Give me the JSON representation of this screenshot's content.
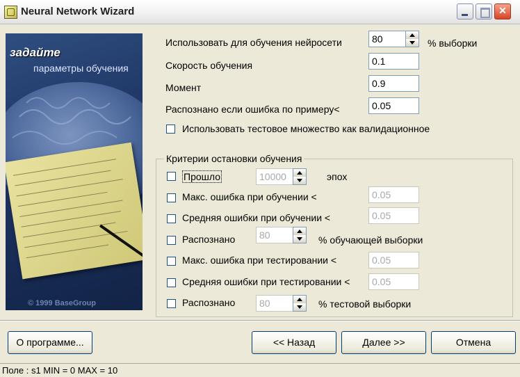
{
  "window": {
    "title": "Neural Network Wizard"
  },
  "side_image": {
    "heading": "задайте",
    "subheading": "параметры обучения",
    "copyright": "© 1999 BaseGroup"
  },
  "training": {
    "sample_use_label": "Использовать для обучения нейросети",
    "sample_use_value": "80",
    "sample_use_unit": "% выборки",
    "learning_rate_label": "Скорость обучения",
    "learning_rate_value": "0.1",
    "momentum_label": "Момент",
    "momentum_value": "0.9",
    "recognized_label": "Распознано если ошибка по примеру<",
    "recognized_value": "0.05",
    "use_test_as_validation_label": "Использовать тестовое множество как валидационное",
    "use_test_as_validation_checked": false
  },
  "stop_criteria": {
    "title": "Критерии остановки обучения",
    "epochs_label": "Прошло",
    "epochs_value": "10000",
    "epochs_unit": "эпох",
    "max_train_error_label": "Макс. ошибка при обучении <",
    "max_train_error_value": "0.05",
    "avg_train_error_label": "Средняя ошибки при обучении <",
    "avg_train_error_value": "0.05",
    "train_recognized_label": "Распознано",
    "train_recognized_value": "80",
    "train_recognized_unit": "% обучающей выборки",
    "max_test_error_label": "Макс. ошибка при тестировании <",
    "max_test_error_value": "0.05",
    "avg_test_error_label": "Средняя ошибки при тестировании <",
    "avg_test_error_value": "0.05",
    "test_recognized_label": "Распознано",
    "test_recognized_value": "80",
    "test_recognized_unit": "% тестовой выборки"
  },
  "buttons": {
    "about": "О программе...",
    "back": "<< Назад",
    "next": "Далее >>",
    "cancel": "Отмена"
  },
  "status_bar": {
    "text": "Поле : s1  MIN = 0 MAX = 10"
  },
  "colors": {
    "accent": "#003c74",
    "disabled_text": "#a8a8a8",
    "background": "#ece9d8"
  }
}
